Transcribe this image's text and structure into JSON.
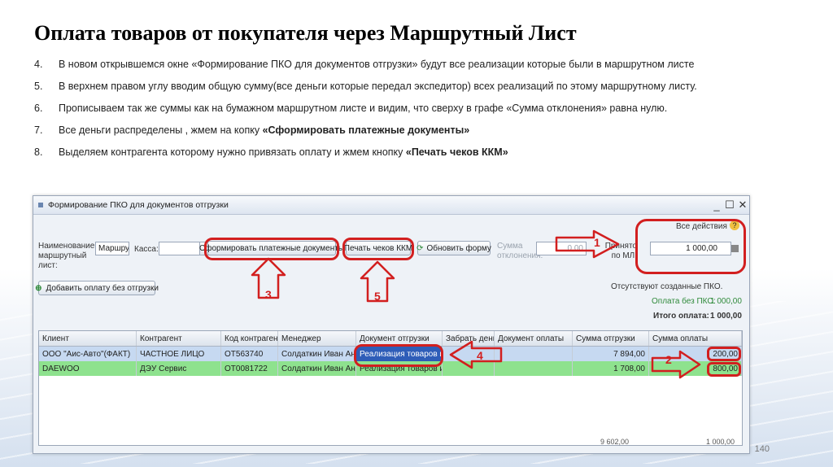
{
  "title": "Оплата товаров от покупателя через Маршрутный Лист",
  "steps": [
    {
      "num": "4.",
      "text": "В новом открывшемся окне «Формирование ПКО для документов отгрузки» будут все реализации которые были в маршрутном листе",
      "bold": ""
    },
    {
      "num": "5.",
      "text": "В верхнем правом углу вводим общую сумму(все деньги которые передал экспедитор) всех реализаций по этому маршрутному листу.",
      "bold": ""
    },
    {
      "num": "6.",
      "text": "Прописываем так же суммы как на бумажном маршрутном листе и видим, что сверху в графе «Сумма отклонения» равна нулю.",
      "bold": ""
    },
    {
      "num": "7.",
      "text": "Все деньги распределены , жмем на копку ",
      "bold": "«Сформировать платежные документы»"
    },
    {
      "num": "8.",
      "text": "Выделяем контрагента которому нужно привязать оплату и жмем кнопку ",
      "bold": "«Печать чеков ККМ»"
    }
  ],
  "window": {
    "title": "Формирование ПКО для документов отгрузки",
    "all_actions": "Все действия ▾",
    "route_label": "Наименование маршрутный лист:",
    "route_value": "Маршрутн",
    "cash_label": "Касса:",
    "cash_dots": "...",
    "btn_form": "Сформировать платежные документы",
    "btn_print": "Печать чеков ККМ",
    "btn_refresh": "Обновить форму",
    "deviation_label": "Сумма отклонения:",
    "deviation_value": "0,00",
    "accepted_label": "Принято по МЛ:",
    "accepted_value": "1 000,00",
    "add_payment": "Добавить оплату без отгрузки",
    "no_pko": "Отсутствуют созданные ПКО.",
    "payment_no_pko_label": "Оплата без ПКО:",
    "payment_no_pko_value": "1 000,00",
    "total_label": "Итого оплата:",
    "total_value": "1 000,00",
    "columns": [
      "Клиент",
      "Контрагент",
      "Код контрагента",
      "Менеджер",
      "Документ отгрузки",
      "Забрать деньги",
      "Документ оплаты",
      "Сумма отгрузки",
      "Сумма оплаты"
    ],
    "rows": [
      [
        "ООО \"Аис-Авто\"(ФАКТ)",
        "ЧАСТНОЕ ЛИЦО",
        "ОТ563740",
        "Солдаткин Иван Андр...",
        "Реализация товаров и у...",
        "",
        "",
        "7 894,00",
        "200,00"
      ],
      [
        "DAEWOO",
        "ДЭУ Сервис",
        "ОТ0081722",
        "Солдаткин Иван Андр...",
        "Реализация товаров и у...",
        "",
        "",
        "1 708,00",
        "800,00"
      ]
    ],
    "footer_left": "9 602,00",
    "footer_right": "1 000,00"
  },
  "annotations": [
    "1",
    "2",
    "3",
    "4",
    "5"
  ],
  "page_number": "140"
}
